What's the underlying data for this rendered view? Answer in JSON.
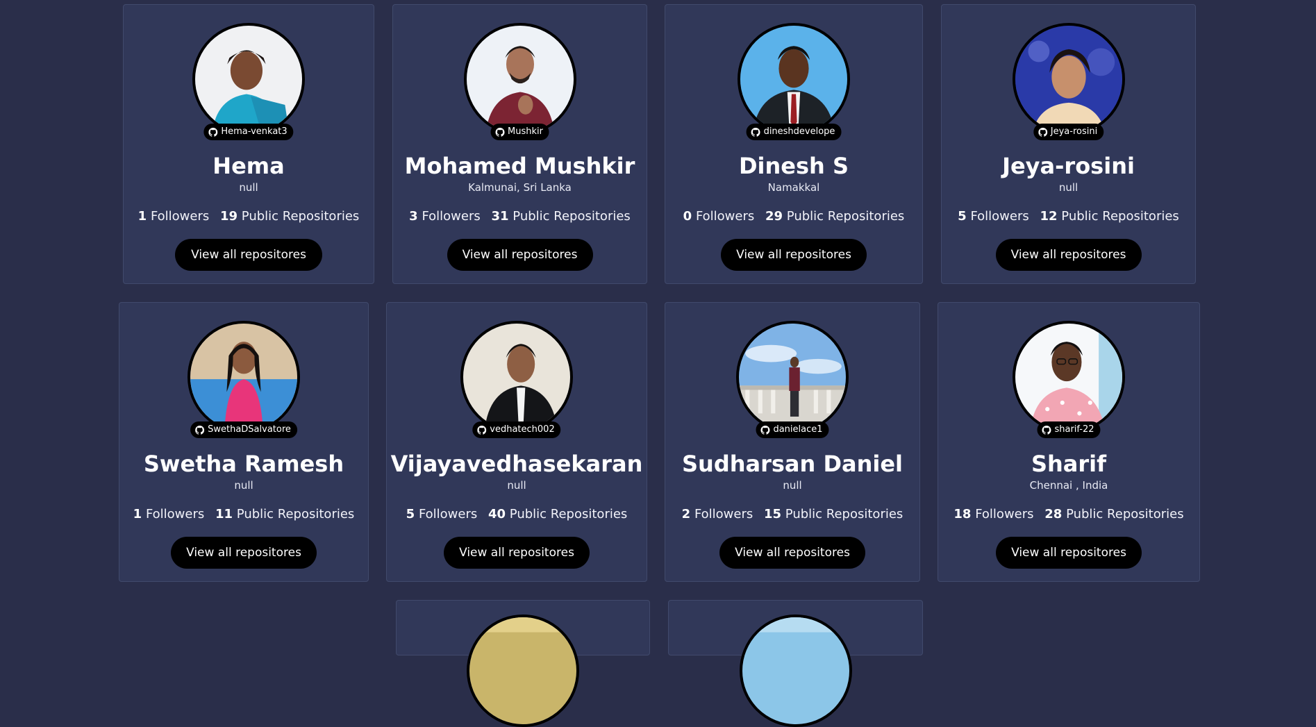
{
  "button_label": "View all repositores",
  "followers_label": "Followers",
  "repos_label": "Public Repositories",
  "cards": [
    {
      "username": "Hema-venkat3",
      "name": "Hema",
      "location": "null",
      "followers": "1",
      "repos": "19"
    },
    {
      "username": "Mushkir",
      "name": "Mohamed Mushkir",
      "location": "Kalmunai, Sri Lanka",
      "followers": "3",
      "repos": "31"
    },
    {
      "username": "dineshdevelope",
      "name": "Dinesh S",
      "location": "Namakkal",
      "followers": "0",
      "repos": "29"
    },
    {
      "username": "Jeya-rosini",
      "name": "Jeya-rosini",
      "location": "null",
      "followers": "5",
      "repos": "12"
    },
    {
      "username": "SwethaDSalvatore",
      "name": "Swetha Ramesh",
      "location": "null",
      "followers": "1",
      "repos": "11"
    },
    {
      "username": "vedhatech002",
      "name": "Vijayavedhasekaran",
      "location": "null",
      "followers": "5",
      "repos": "40"
    },
    {
      "username": "danielace1",
      "name": "Sudharsan Daniel",
      "location": "null",
      "followers": "2",
      "repos": "15"
    },
    {
      "username": "sharif-22",
      "name": "Sharif",
      "location": "Chennai , India",
      "followers": "18",
      "repos": "28"
    }
  ],
  "colors": {
    "background": "#2a2e4a",
    "card": "#313859",
    "card_border": "#414a6c",
    "button": "#000000"
  },
  "icons": {
    "badge": "github-icon"
  }
}
